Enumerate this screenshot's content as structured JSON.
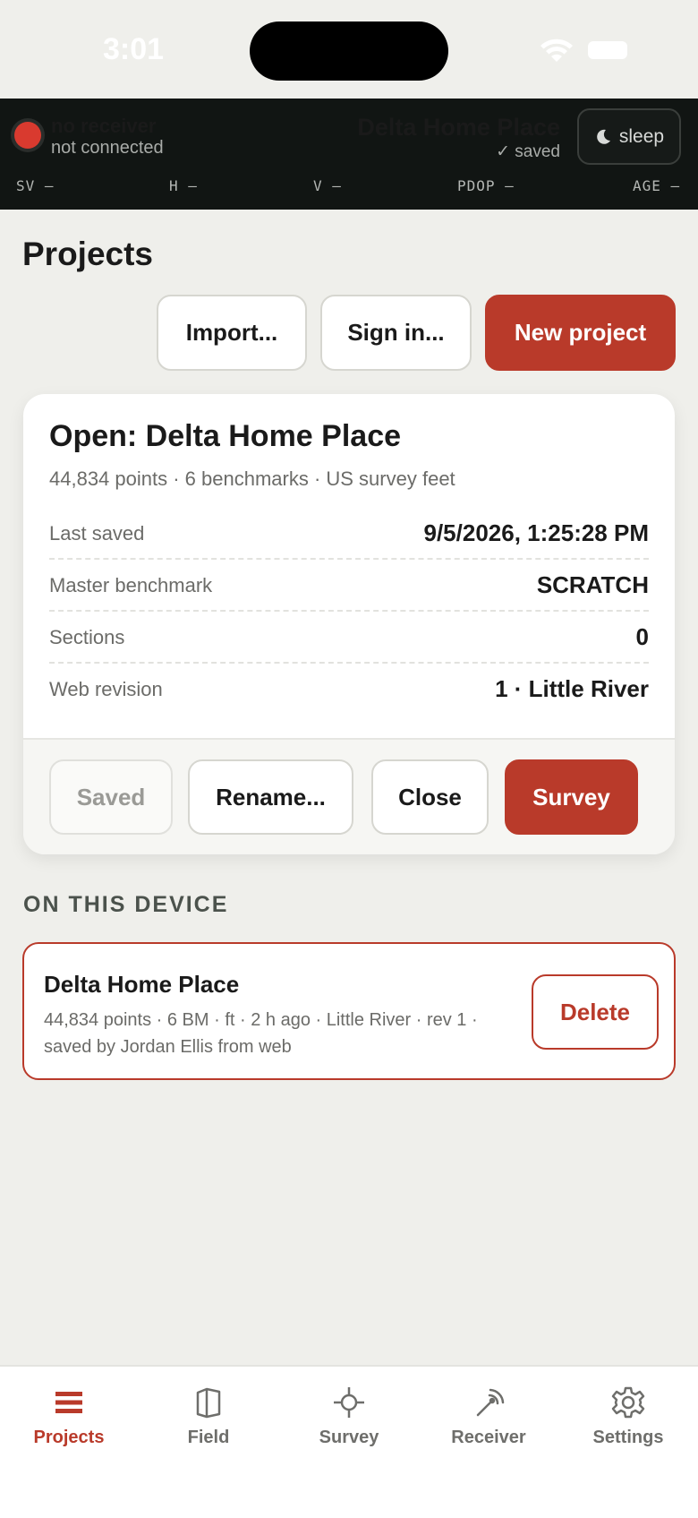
{
  "status_bar": {
    "time": "3:01"
  },
  "receiver": {
    "name": "no receiver",
    "status": "not connected",
    "project_name": "Delta Home Place",
    "save_status": "✓ saved",
    "sleep_label": "sleep",
    "metrics": [
      {
        "label": "SV",
        "value": "—"
      },
      {
        "label": "H",
        "value": "—"
      },
      {
        "label": "V",
        "value": "—"
      },
      {
        "label": "PDOP",
        "value": "—"
      },
      {
        "label": "AGE",
        "value": "—"
      }
    ]
  },
  "page": {
    "title": "Projects",
    "actions": {
      "import": "Import...",
      "sign_in": "Sign in...",
      "new_project": "New project"
    }
  },
  "open_project": {
    "title": "Open: Delta Home Place",
    "subtitle": "44,834 points · 6 benchmarks · US survey feet",
    "rows": [
      {
        "key": "Last saved",
        "value": "9/5/2026, 1:25:28 PM"
      },
      {
        "key": "Master benchmark",
        "value": "SCRATCH"
      },
      {
        "key": "Sections",
        "value": "0"
      },
      {
        "key": "Web revision",
        "value": "1 · Little River"
      }
    ],
    "buttons": {
      "saved": "Saved",
      "rename": "Rename...",
      "close": "Close",
      "survey": "Survey"
    }
  },
  "device_section": {
    "label": "ON THIS DEVICE",
    "items": [
      {
        "title": "Delta Home Place",
        "meta": "44,834 points · 6 BM · ft · 2 h ago · Little River · rev 1 · saved by Jordan Ellis from web",
        "delete_label": "Delete"
      }
    ]
  },
  "tabs": [
    {
      "label": "Projects",
      "icon": "list-icon",
      "active": true
    },
    {
      "label": "Field",
      "icon": "map-book-icon",
      "active": false
    },
    {
      "label": "Survey",
      "icon": "crosshair-icon",
      "active": false
    },
    {
      "label": "Receiver",
      "icon": "antenna-icon",
      "active": false
    },
    {
      "label": "Settings",
      "icon": "gear-icon",
      "active": false
    }
  ],
  "colors": {
    "accent": "#b93a2a",
    "header_bg": "#111513",
    "page_bg": "#efefeb",
    "receiver_dot": "#d93a2f"
  }
}
